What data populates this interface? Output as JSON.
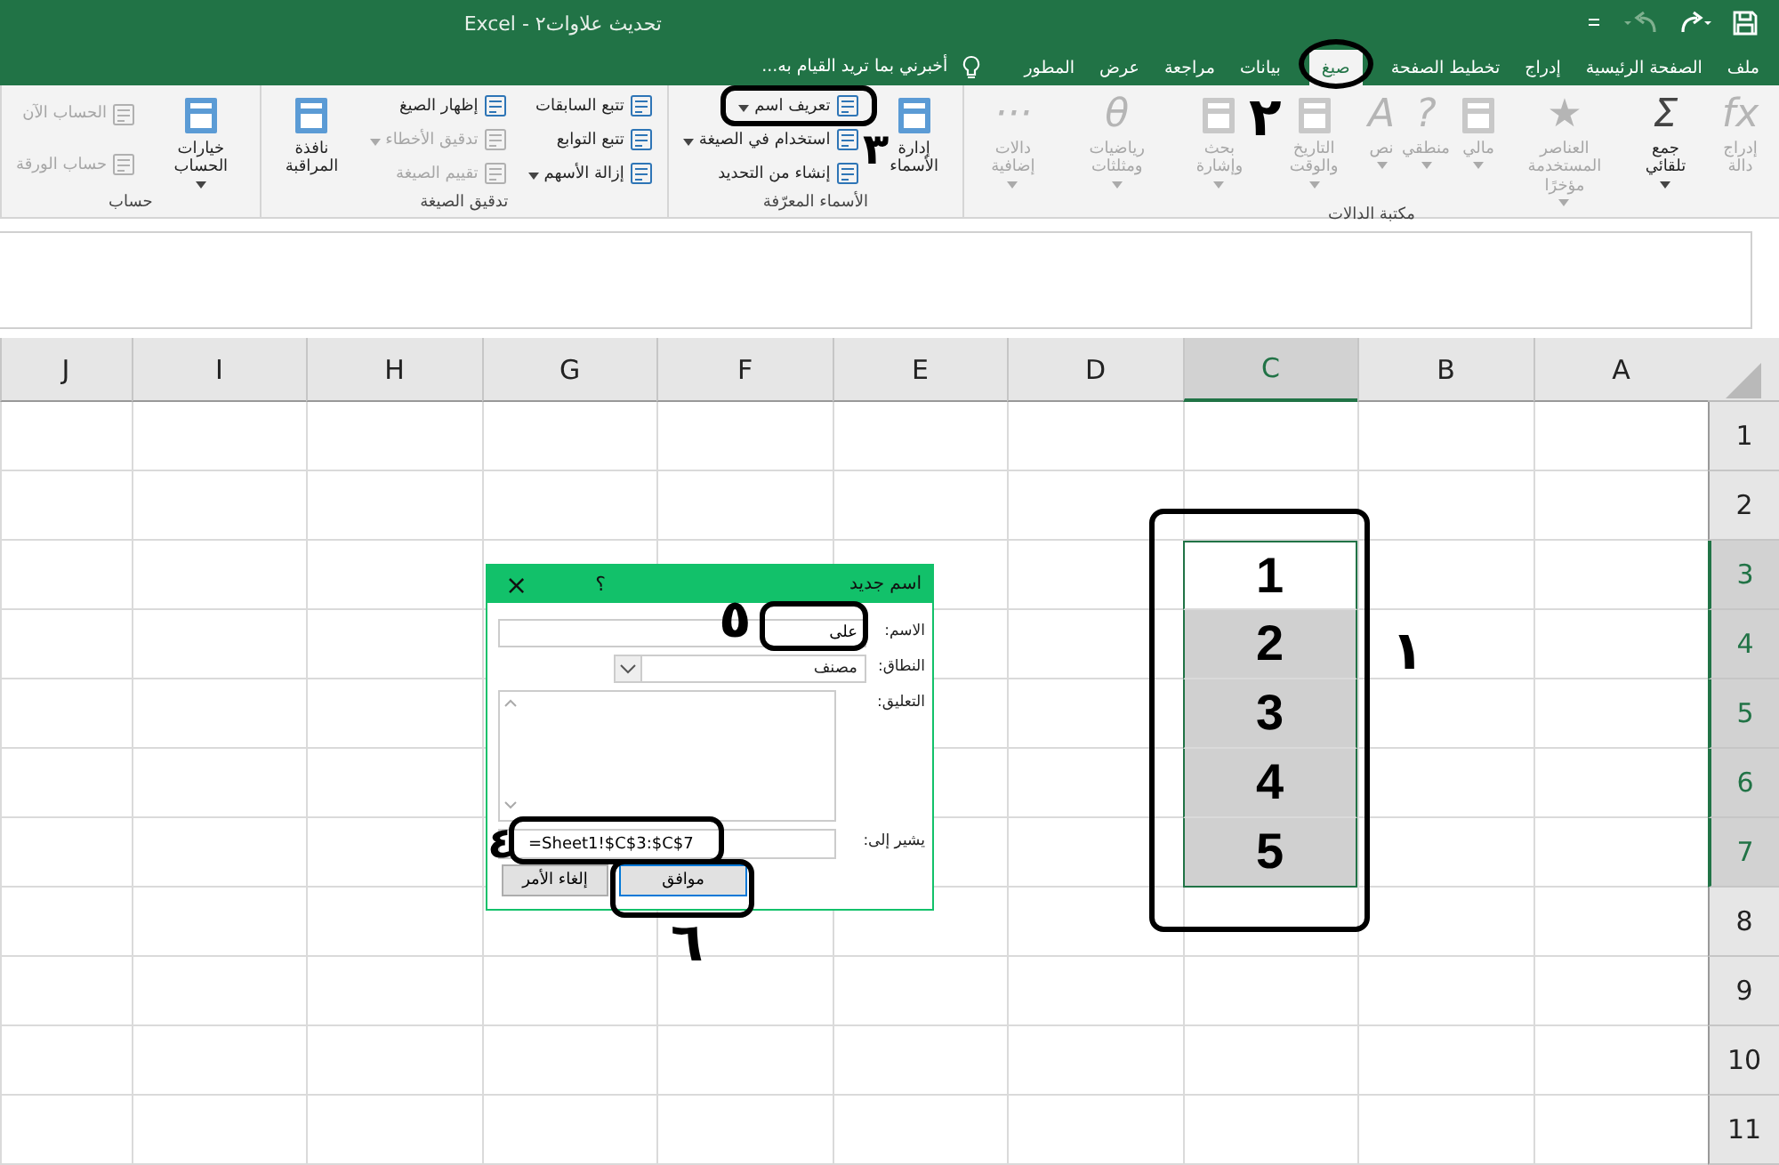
{
  "window": {
    "title": "تحديث علاوات٢ - Excel"
  },
  "tabs": [
    {
      "label": "ملف",
      "selected": false
    },
    {
      "label": "الصفحة الرئيسية",
      "selected": false
    },
    {
      "label": "إدراج",
      "selected": false
    },
    {
      "label": "تخطيط الصفحة",
      "selected": false
    },
    {
      "label": "صيغ",
      "selected": true
    },
    {
      "label": "بيانات",
      "selected": false
    },
    {
      "label": "مراجعة",
      "selected": false
    },
    {
      "label": "عرض",
      "selected": false
    },
    {
      "label": "المطور",
      "selected": false
    }
  ],
  "tell_me": {
    "label": "أخبرني بما تريد القيام به..."
  },
  "ribbon": [
    {
      "label": "مكتبة الدالات",
      "columns": [
        {
          "kind": "large",
          "items": [
            {
              "label": "إدراج دالة",
              "glyph": "fx",
              "disabled": true,
              "dropdown": false
            }
          ]
        },
        {
          "kind": "large",
          "items": [
            {
              "label": "جمع تلقائي",
              "glyph": "Σ",
              "disabled": false,
              "dropdown": true
            }
          ]
        },
        {
          "kind": "large",
          "items": [
            {
              "label": "العناصر المستخدمة مؤخرًا",
              "glyph": "★",
              "disabled": true,
              "dropdown": true
            }
          ]
        },
        {
          "kind": "large",
          "items": [
            {
              "label": "مالي",
              "disabled": true,
              "dropdown": true
            }
          ]
        },
        {
          "kind": "large",
          "items": [
            {
              "label": "منطقي",
              "glyph": "?",
              "disabled": true,
              "dropdown": true
            }
          ]
        },
        {
          "kind": "large",
          "items": [
            {
              "label": "نص",
              "glyph": "A",
              "disabled": true,
              "dropdown": true
            }
          ]
        },
        {
          "kind": "large",
          "items": [
            {
              "label": "التاريخ والوقت",
              "disabled": true,
              "dropdown": true
            }
          ]
        },
        {
          "kind": "large",
          "items": [
            {
              "label": "بحث وإشارة",
              "disabled": true,
              "dropdown": true
            }
          ]
        },
        {
          "kind": "large",
          "items": [
            {
              "label": "رياضيات ومثلثات",
              "glyph": "θ",
              "disabled": true,
              "dropdown": true
            }
          ]
        },
        {
          "kind": "large",
          "items": [
            {
              "label": "دالات إضافية",
              "glyph": "···",
              "disabled": true,
              "dropdown": true
            }
          ]
        }
      ]
    },
    {
      "label": "الأسماء المعرّفة",
      "columns": [
        {
          "kind": "large",
          "items": [
            {
              "label": "إدارة الأسماء",
              "disabled": false,
              "dropdown": false
            }
          ]
        },
        {
          "kind": "small",
          "items": [
            {
              "label": "تعريف اسم",
              "disabled": false,
              "dropdown": true
            },
            {
              "label": "استخدام في الصيغة",
              "disabled": false,
              "dropdown": true
            },
            {
              "label": "إنشاء من التحديد",
              "disabled": false,
              "dropdown": false
            }
          ]
        }
      ]
    },
    {
      "label": "تدقيق الصيغة",
      "columns": [
        {
          "kind": "small",
          "items": [
            {
              "label": "تتبع السابقات",
              "disabled": false,
              "dropdown": false
            },
            {
              "label": "تتبع التوابع",
              "disabled": false,
              "dropdown": false
            },
            {
              "label": "إزالة الأسهم",
              "disabled": false,
              "dropdown": true
            }
          ]
        },
        {
          "kind": "small",
          "items": [
            {
              "label": "إظهار الصيغ",
              "disabled": false,
              "dropdown": false
            },
            {
              "label": "تدقيق الأخطاء",
              "disabled": true,
              "dropdown": true
            },
            {
              "label": "تقييم الصيغة",
              "disabled": true,
              "dropdown": false
            }
          ]
        },
        {
          "kind": "large",
          "items": [
            {
              "label": "نافذة المراقبة",
              "disabled": false,
              "dropdown": false
            }
          ]
        }
      ]
    },
    {
      "label": "حساب",
      "columns": [
        {
          "kind": "large",
          "items": [
            {
              "label": "خيارات الحساب",
              "disabled": false,
              "dropdown": true
            }
          ]
        },
        {
          "kind": "small",
          "items": [
            {
              "label": "الحساب الآن",
              "disabled": true,
              "dropdown": false
            },
            {
              "label": "حساب الورقة",
              "disabled": true,
              "dropdown": false
            }
          ]
        }
      ]
    }
  ],
  "sheet": {
    "columns": [
      {
        "label": "A",
        "selected": false
      },
      {
        "label": "B",
        "selected": false
      },
      {
        "label": "C",
        "selected": true
      },
      {
        "label": "D",
        "selected": false
      },
      {
        "label": "E",
        "selected": false
      },
      {
        "label": "F",
        "selected": false
      },
      {
        "label": "G",
        "selected": false
      },
      {
        "label": "H",
        "selected": false
      },
      {
        "label": "I",
        "selected": false
      },
      {
        "label": "J",
        "selected": false
      }
    ],
    "rows": [
      {
        "label": "1",
        "selected": false
      },
      {
        "label": "2",
        "selected": false
      },
      {
        "label": "3",
        "selected": true
      },
      {
        "label": "4",
        "selected": true
      },
      {
        "label": "5",
        "selected": true
      },
      {
        "label": "6",
        "selected": true
      },
      {
        "label": "7",
        "selected": true
      },
      {
        "label": "8",
        "selected": false
      },
      {
        "label": "9",
        "selected": false
      },
      {
        "label": "10",
        "selected": false
      },
      {
        "label": "11",
        "selected": false
      }
    ],
    "selection_values": [
      {
        "text": "1",
        "active": true
      },
      {
        "text": "2",
        "active": false
      },
      {
        "text": "3",
        "active": false
      },
      {
        "text": "4",
        "active": false
      },
      {
        "text": "5",
        "active": false
      }
    ]
  },
  "dialog": {
    "title": "اسم جديد",
    "help": "؟",
    "close": "×",
    "name_label": "الاسم:",
    "name_value": "على",
    "scope_label": "النطاق:",
    "scope_value": "مصنف",
    "comment_label": "التعليق:",
    "refers_label": "يشير إلى:",
    "refers_value": "=Sheet1!$C$3:$C$7",
    "buttons": [
      {
        "label": "موافق",
        "kind": "default"
      },
      {
        "label": "إلغاء الأمر",
        "kind": "normal"
      }
    ]
  },
  "annotations": [
    {
      "text": "١"
    },
    {
      "text": "٢"
    },
    {
      "text": "٣"
    },
    {
      "text": "٤"
    },
    {
      "text": "٥"
    },
    {
      "text": "٦"
    }
  ]
}
